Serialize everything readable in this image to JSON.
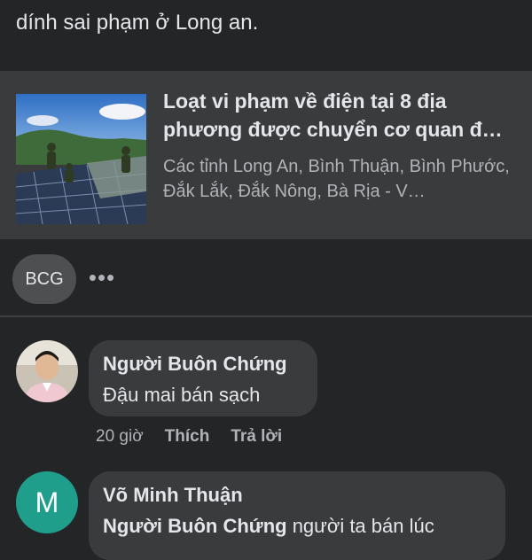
{
  "post": {
    "text_line": "dính sai phạm ở Long an."
  },
  "link_preview": {
    "title": "Loạt vi phạm về điện tại 8 địa phương được chuyển cơ quan đ…",
    "description": "Các tỉnh Long An, Bình Thuận, Bình Phước, Đắk Lắk, Đắk Nông, Bà Rịa - V…"
  },
  "reactions": {
    "chip_label": "BCG",
    "more_label": "•••"
  },
  "comments": [
    {
      "author": "Người Buôn Chứng",
      "text": "Đậu mai bán sạch",
      "time": "20 giờ",
      "like_label": "Thích",
      "reply_label": "Trả lời"
    },
    {
      "initial": "M",
      "author": "Võ Minh Thuận",
      "mention": "Người Buôn Chứng",
      "text": " người ta bán lúc"
    }
  ],
  "colors": {
    "background": "#242526",
    "card": "#3a3b3c",
    "avatar_m": "#1f9e8c"
  }
}
